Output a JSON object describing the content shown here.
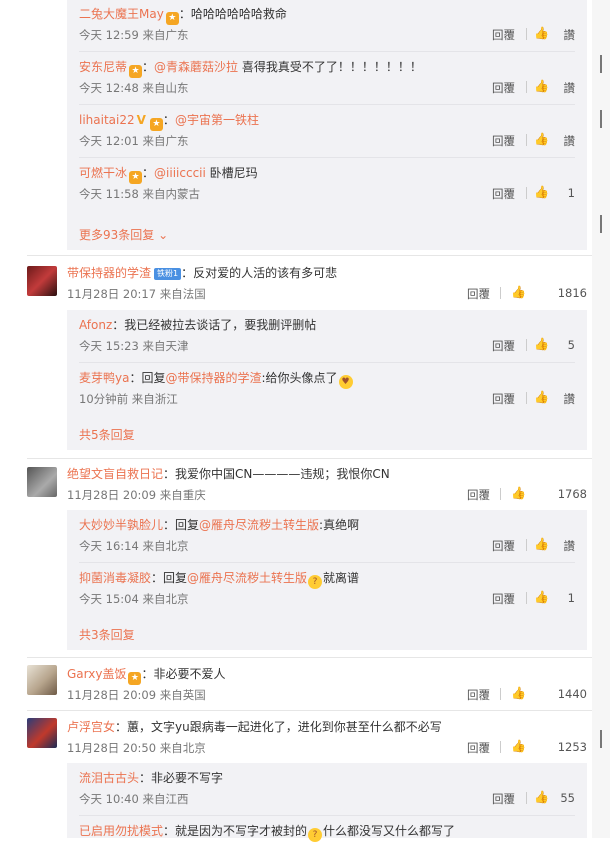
{
  "labels": {
    "reply": "回覆",
    "like": "讚"
  },
  "thread1": {
    "replies": [
      {
        "user": "二兔大魔王May",
        "text": "：哈哈哈哈哈哈救命",
        "time": "今天 12:59 来自广东",
        "likes": "讚"
      },
      {
        "user": "安东尼蒂",
        "mention": "@青森蘑菇沙拉",
        "text": " 喜得我真受不了了！！！！！！！",
        "time": "今天 12:48 来自山东",
        "likes": "讚"
      },
      {
        "user": "lihaitai22",
        "mention": "@宇宙第一铁柱",
        "text": "",
        "time": "今天 12:01 来自广东",
        "likes": "讚"
      },
      {
        "user": "可燃干冰",
        "mention": "@iiiicccii",
        "text": " 卧槽尼玛",
        "time": "今天 11:58 来自内蒙古",
        "likes": "1"
      }
    ],
    "more": "更多93条回复"
  },
  "comments": [
    {
      "user": "带保持器的学渣",
      "level": "铁粉1",
      "text": "：反对爱的人活的该有多可悲",
      "time": "11月28日 20:17 来自法国",
      "likes": "1816",
      "replies": [
        {
          "user": "Afonz",
          "text": "：我已经被拉去谈话了，要我删评删帖",
          "time": "今天 15:23 来自天津",
          "likes": "5"
        },
        {
          "user": "麦芽鸭ya",
          "prefix": "：回复",
          "mention": "@带保持器的学渣",
          "text": ":给你头像点了",
          "time": "10分钟前 来自浙江",
          "likes": "讚"
        }
      ],
      "more": "共5条回复"
    },
    {
      "user": "绝望文盲自救日记",
      "text": "：我爱你中国CN————违规；我恨你CN",
      "time": "11月28日 20:09 来自重庆",
      "likes": "1768",
      "replies": [
        {
          "user": "大妙妙半孰脸儿",
          "prefix": "：回复",
          "mention": "@雁舟尽流秽土转生版",
          "text": ":真绝啊",
          "time": "今天 16:14 来自北京",
          "likes": "讚"
        },
        {
          "user": "抑菌消毒凝胶",
          "prefix": "：回复",
          "mention": "@雁舟尽流秽土转生版",
          "text": "就离谱",
          "time": "今天 15:04 来自北京",
          "likes": "1"
        }
      ],
      "more": "共3条回复"
    },
    {
      "user": "Garxy盖饭",
      "text": "：非必要不爱人",
      "time": "11月28日 20:09 来自英国",
      "likes": "1440"
    },
    {
      "user": "卢浮宫女",
      "text": "：蕙，文字yu跟病毒一起进化了，进化到你甚至什么都不必写",
      "time": "11月28日 20:50 来自北京",
      "likes": "1253",
      "replies": [
        {
          "user": "流泪古古头",
          "text": "：非必要不写字",
          "time": "今天 10:40 来自江西",
          "likes": "55"
        },
        {
          "user": "已启用勿扰模式",
          "text": "：就是因为不写字才被封的",
          "text2": "什么都没写又什么都写了"
        }
      ]
    }
  ],
  "colors": {
    "accent": "#eb7350",
    "panel": "#f2f2f5"
  }
}
